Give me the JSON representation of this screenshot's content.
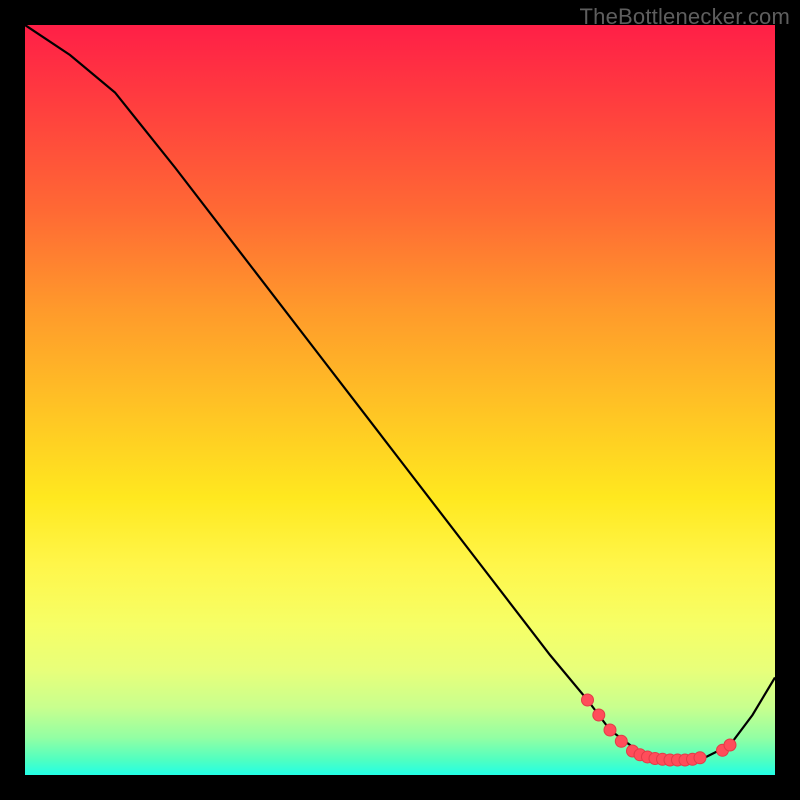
{
  "watermark": "TheBottlenecker.com",
  "chart_data": {
    "type": "line",
    "note": "Axes are not labeled in the source image; numeric positions are read off pixel grid of the 750×750 plot area. Y is bottleneck-style percentage where 0 is bottom (green) and 100 is top (red). X is an unlabeled horizontal spectrum 0–100.",
    "xlim": [
      0,
      100
    ],
    "ylim": [
      0,
      100
    ],
    "xlabel": "",
    "ylabel": "",
    "title": "",
    "series": [
      {
        "name": "curve",
        "x": [
          0,
          6,
          12,
          20,
          30,
          40,
          50,
          60,
          70,
          75,
          78,
          82,
          86,
          90,
          94,
          97,
          100
        ],
        "y": [
          100,
          96,
          91,
          81,
          68,
          55,
          42,
          29,
          16,
          10,
          6,
          3,
          2,
          2,
          4,
          8,
          13
        ]
      }
    ],
    "markers": [
      {
        "x": 75,
        "y": 10
      },
      {
        "x": 76.5,
        "y": 8
      },
      {
        "x": 78,
        "y": 6
      },
      {
        "x": 79.5,
        "y": 4.5
      },
      {
        "x": 81,
        "y": 3.2
      },
      {
        "x": 82,
        "y": 2.7
      },
      {
        "x": 83,
        "y": 2.4
      },
      {
        "x": 84,
        "y": 2.2
      },
      {
        "x": 85,
        "y": 2.1
      },
      {
        "x": 86,
        "y": 2.0
      },
      {
        "x": 87,
        "y": 2.0
      },
      {
        "x": 88,
        "y": 2.0
      },
      {
        "x": 89,
        "y": 2.1
      },
      {
        "x": 90,
        "y": 2.3
      },
      {
        "x": 93,
        "y": 3.3
      },
      {
        "x": 94,
        "y": 4.0
      }
    ],
    "colors": {
      "curve": "#000000",
      "markers": "#ff4d5a",
      "gradient_top": "#ff1f47",
      "gradient_bottom": "#22ffe6"
    }
  }
}
